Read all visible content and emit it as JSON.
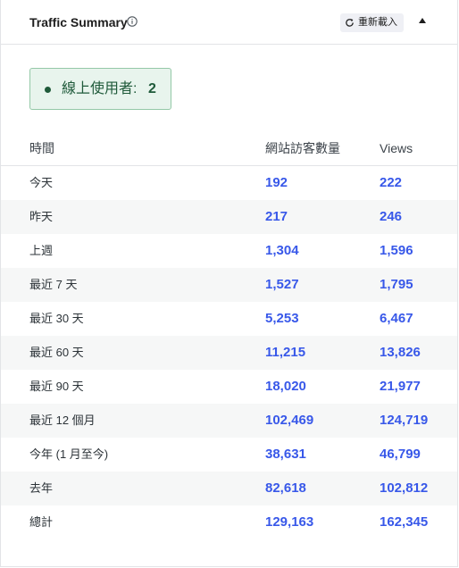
{
  "header": {
    "title": "Traffic Summary",
    "info_icon": "info-circle-icon",
    "reload_label": "重新載入",
    "reload_icon": "refresh-icon",
    "collapse_icon": "triangle-up-icon"
  },
  "online": {
    "label": "線上使用者:",
    "count": "2",
    "status_color": "#1f5a3a"
  },
  "table": {
    "columns": [
      "時間",
      "網站訪客數量",
      "Views"
    ],
    "rows": [
      {
        "period": "今天",
        "visitors": "192",
        "views": "222"
      },
      {
        "period": "昨天",
        "visitors": "217",
        "views": "246"
      },
      {
        "period": "上週",
        "visitors": "1,304",
        "views": "1,596"
      },
      {
        "period": "最近 7 天",
        "visitors": "1,527",
        "views": "1,795"
      },
      {
        "period": "最近 30 天",
        "visitors": "5,253",
        "views": "6,467"
      },
      {
        "period": "最近 60 天",
        "visitors": "11,215",
        "views": "13,826"
      },
      {
        "period": "最近 90 天",
        "visitors": "18,020",
        "views": "21,977"
      },
      {
        "period": "最近 12 個月",
        "visitors": "102,469",
        "views": "124,719"
      },
      {
        "period": "今年 (1 月至今)",
        "visitors": "38,631",
        "views": "46,799"
      },
      {
        "period": "去年",
        "visitors": "82,618",
        "views": "102,812"
      },
      {
        "period": "總計",
        "visitors": "129,163",
        "views": "162,345"
      }
    ]
  },
  "colors": {
    "accent": "#3858e9",
    "online_bg": "#e8f4ed",
    "online_border": "#94c8a7",
    "row_alt": "#f6f7f7"
  }
}
